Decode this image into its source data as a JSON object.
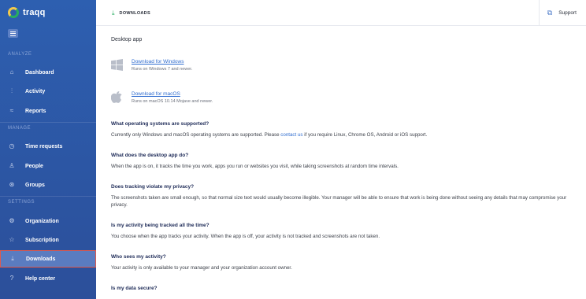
{
  "app": {
    "name": "traqq"
  },
  "sidebar": {
    "sections": [
      "ANALYZE",
      "MANAGE",
      "SETTINGS"
    ],
    "items": [
      {
        "label": "Dashboard",
        "icon": "home-icon"
      },
      {
        "label": "Activity",
        "icon": "bar-chart-icon"
      },
      {
        "label": "Reports",
        "icon": "trend-icon"
      },
      {
        "label": "Time requests",
        "icon": "clock-icon"
      },
      {
        "label": "People",
        "icon": "people-icon"
      },
      {
        "label": "Groups",
        "icon": "groups-icon"
      },
      {
        "label": "Organization",
        "icon": "gear-icon"
      },
      {
        "label": "Subscription",
        "icon": "star-icon"
      },
      {
        "label": "Downloads",
        "icon": "download-icon",
        "active": true
      },
      {
        "label": "Help center",
        "icon": "help-icon"
      }
    ]
  },
  "header": {
    "breadcrumb": "DOWNLOADS",
    "support_label": "Support"
  },
  "main": {
    "heading": "Desktop app",
    "downloads": [
      {
        "link": "Download for Windows",
        "sub": "Runs on Windows 7 and newer.",
        "icon": "windows-icon"
      },
      {
        "link": "Download for macOS",
        "sub": "Runs on macOS 10.14 Mojave and newer.",
        "icon": "apple-icon"
      }
    ],
    "faq": [
      {
        "q": "What operating systems are supported?",
        "a_pre": "Currently only Windows and macOS operating systems are supported. Please ",
        "a_link": "contact us",
        "a_post": " if you require Linux, Chrome OS, Android or iOS support."
      },
      {
        "q": "What does the desktop app do?",
        "a": "When the app is on, it tracks the time you work, apps you run or websites you visit, while taking screenshots at random time intervals."
      },
      {
        "q": "Does tracking violate my privacy?",
        "a": "The screenshots taken are small enough, so that normal size text would usually become illegible. Your manager will be able to ensure that work is being done without seeing any details that may compromise your privacy."
      },
      {
        "q": "Is my activity being tracked all the time?",
        "a": "You choose when the app tracks your activity. When the app is off, your activity is not tracked and screenshots are not taken."
      },
      {
        "q": "Who sees my activity?",
        "a": "Your activity is only available to your manager and your organization account owner."
      },
      {
        "q": "Is my data secure?",
        "a": ""
      }
    ]
  },
  "colors": {
    "sidebar": "#2d5fb0",
    "active_border": "#e0594c",
    "link": "#2f6ccf",
    "question": "#1d2a57"
  }
}
